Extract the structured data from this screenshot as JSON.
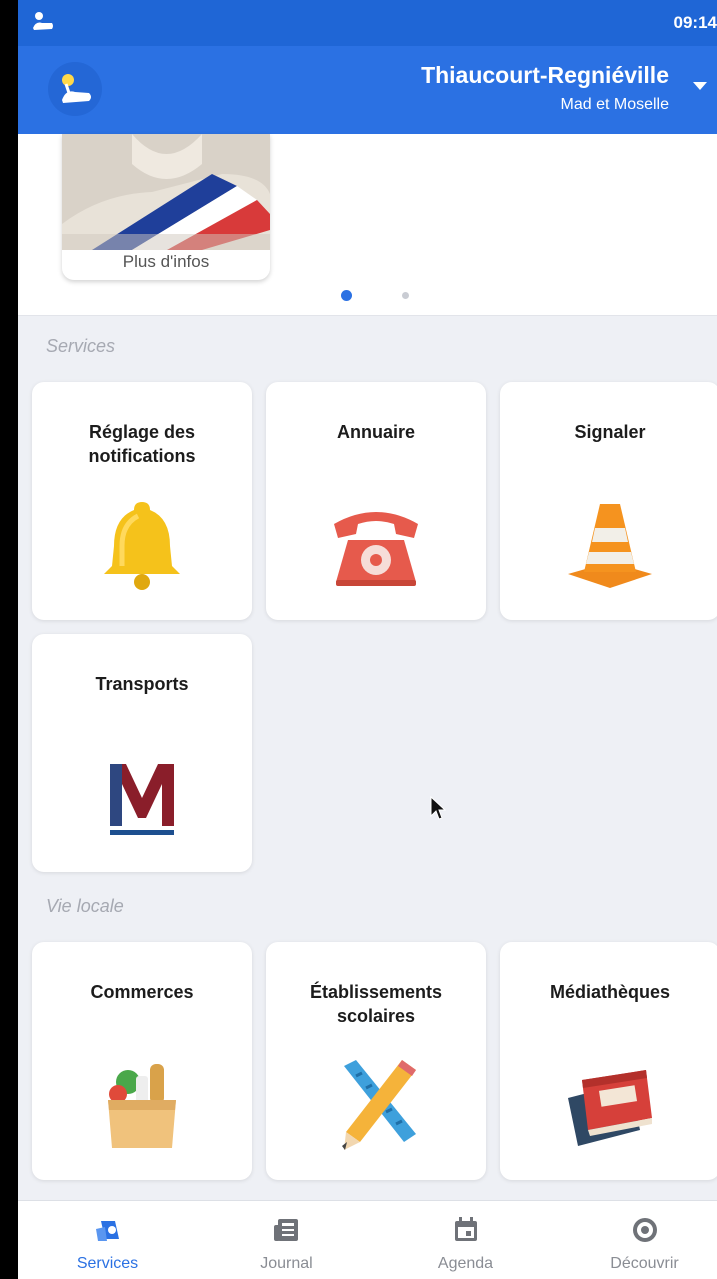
{
  "status_bar": {
    "time": "09:14"
  },
  "app_bar": {
    "city": "Thiaucourt-Regniéville",
    "region": "Mad et Moselle"
  },
  "carousel": {
    "more_label": "Plus d'infos"
  },
  "sections": {
    "services": {
      "title": "Services",
      "tiles": [
        {
          "label": "Réglage des notifications",
          "icon": "bell-icon"
        },
        {
          "label": "Annuaire",
          "icon": "telephone-icon"
        },
        {
          "label": "Signaler",
          "icon": "traffic-cone-icon"
        },
        {
          "label": "Transports",
          "icon": "transport-m-logo"
        }
      ]
    },
    "vie_locale": {
      "title": "Vie locale",
      "tiles": [
        {
          "label": "Commerces",
          "icon": "grocery-bag-icon"
        },
        {
          "label": "Établissements scolaires",
          "icon": "ruler-pencil-icon"
        },
        {
          "label": "Médiathèques",
          "icon": "books-icon"
        }
      ]
    }
  },
  "bottom_nav": {
    "items": [
      {
        "label": "Services",
        "active": true
      },
      {
        "label": "Journal",
        "active": false
      },
      {
        "label": "Agenda",
        "active": false
      },
      {
        "label": "Découvrir",
        "active": false
      }
    ]
  },
  "colors": {
    "primary": "#2b71e3",
    "status_bar": "#1f66d6",
    "background": "#eef0f5"
  }
}
